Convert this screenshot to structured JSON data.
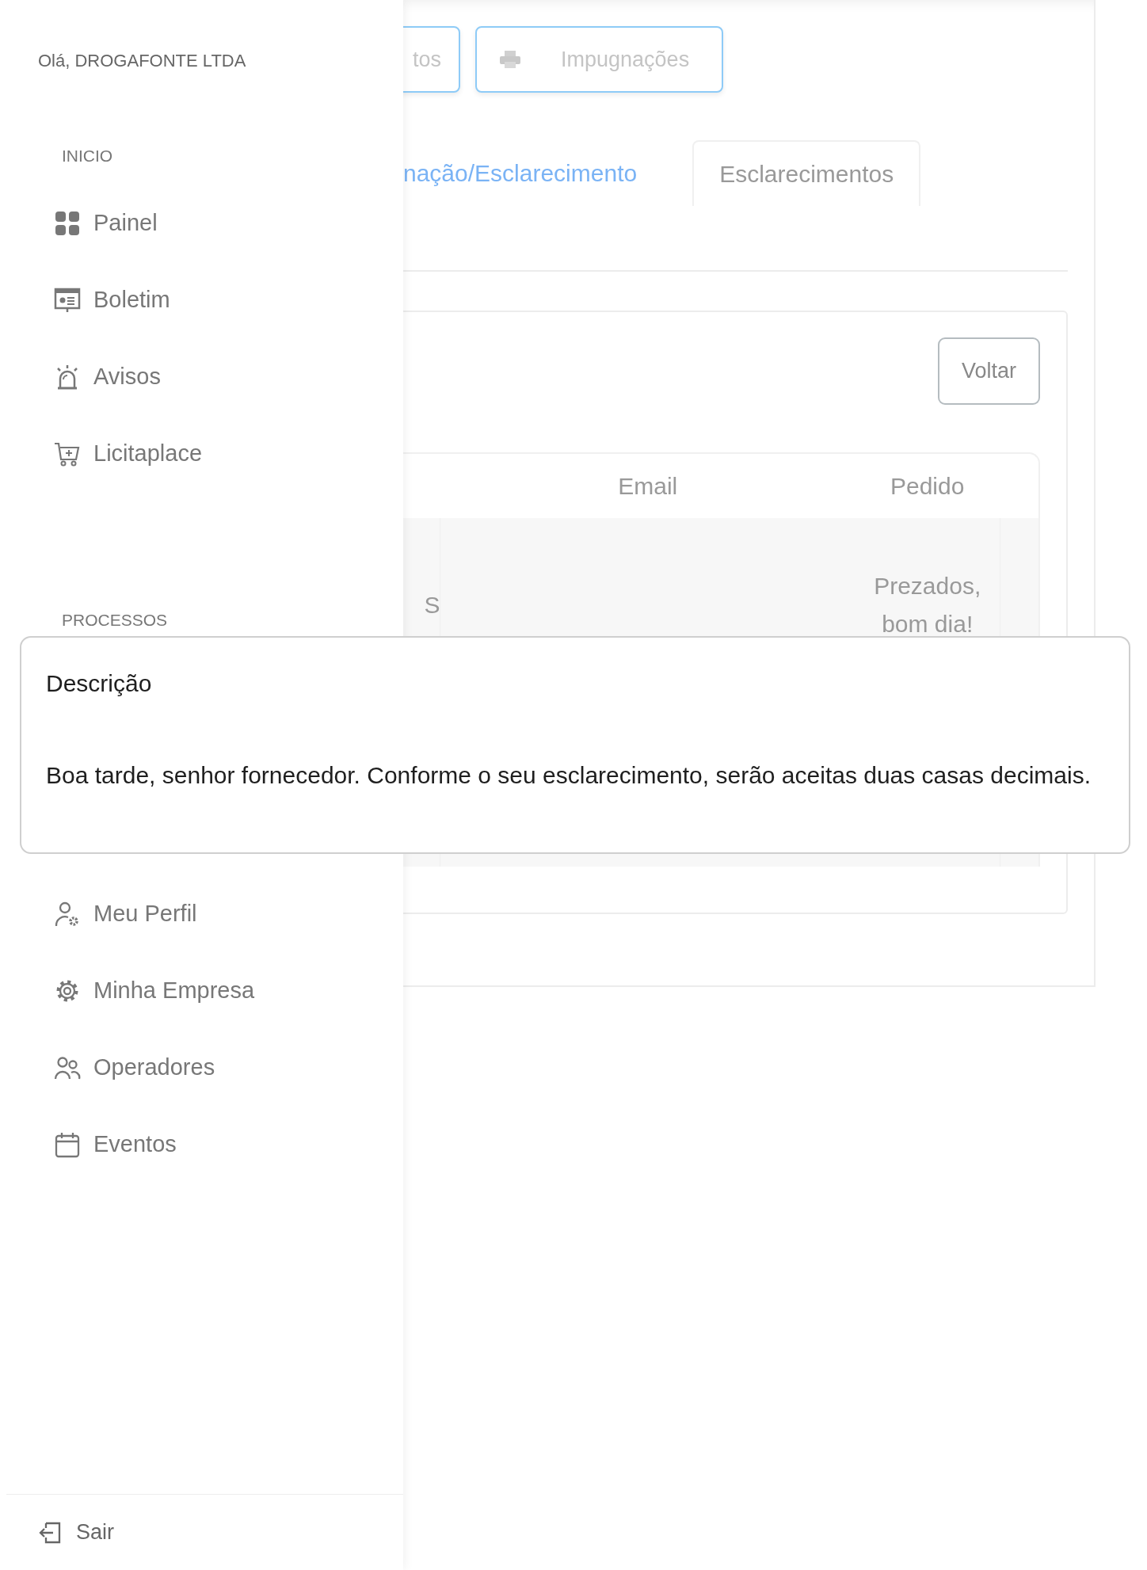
{
  "greeting": "Olá, DROGAFONTE LTDA",
  "sidebar": {
    "sections": [
      {
        "title": "INICIO",
        "items": [
          {
            "label": "Painel",
            "kind": "grid"
          },
          {
            "label": "Boletim",
            "kind": "board"
          },
          {
            "label": "Avisos",
            "kind": "alarm"
          },
          {
            "label": "Licitaplace",
            "kind": "cart"
          }
        ]
      },
      {
        "title": "PROCESSOS"
      },
      {
        "items": [
          {
            "label": "Meu Perfil",
            "kind": "user-gear"
          },
          {
            "label": "Minha Empresa",
            "kind": "gear"
          },
          {
            "label": "Operadores",
            "kind": "users"
          },
          {
            "label": "Eventos",
            "kind": "calendar"
          }
        ]
      }
    ],
    "logout": "Sair"
  },
  "top_buttons": [
    {
      "label": "tos"
    },
    {
      "label": "Impugnações",
      "kind": "printer"
    }
  ],
  "tabs": [
    {
      "label": "nação/Esclarecimento",
      "selected": false
    },
    {
      "label": "Esclarecimentos",
      "selected": true
    }
  ],
  "back_button": "Voltar",
  "table": {
    "columns": [
      "",
      "Email",
      "Pedido"
    ],
    "rows": [
      [
        "S",
        "",
        "Prezados, bom dia!"
      ]
    ]
  },
  "dialog": {
    "title": "Descrição",
    "body": "Boa tarde, senhor fornecedor. Conforme o seu esclarecimento, serão aceitas duas casas decimais."
  }
}
